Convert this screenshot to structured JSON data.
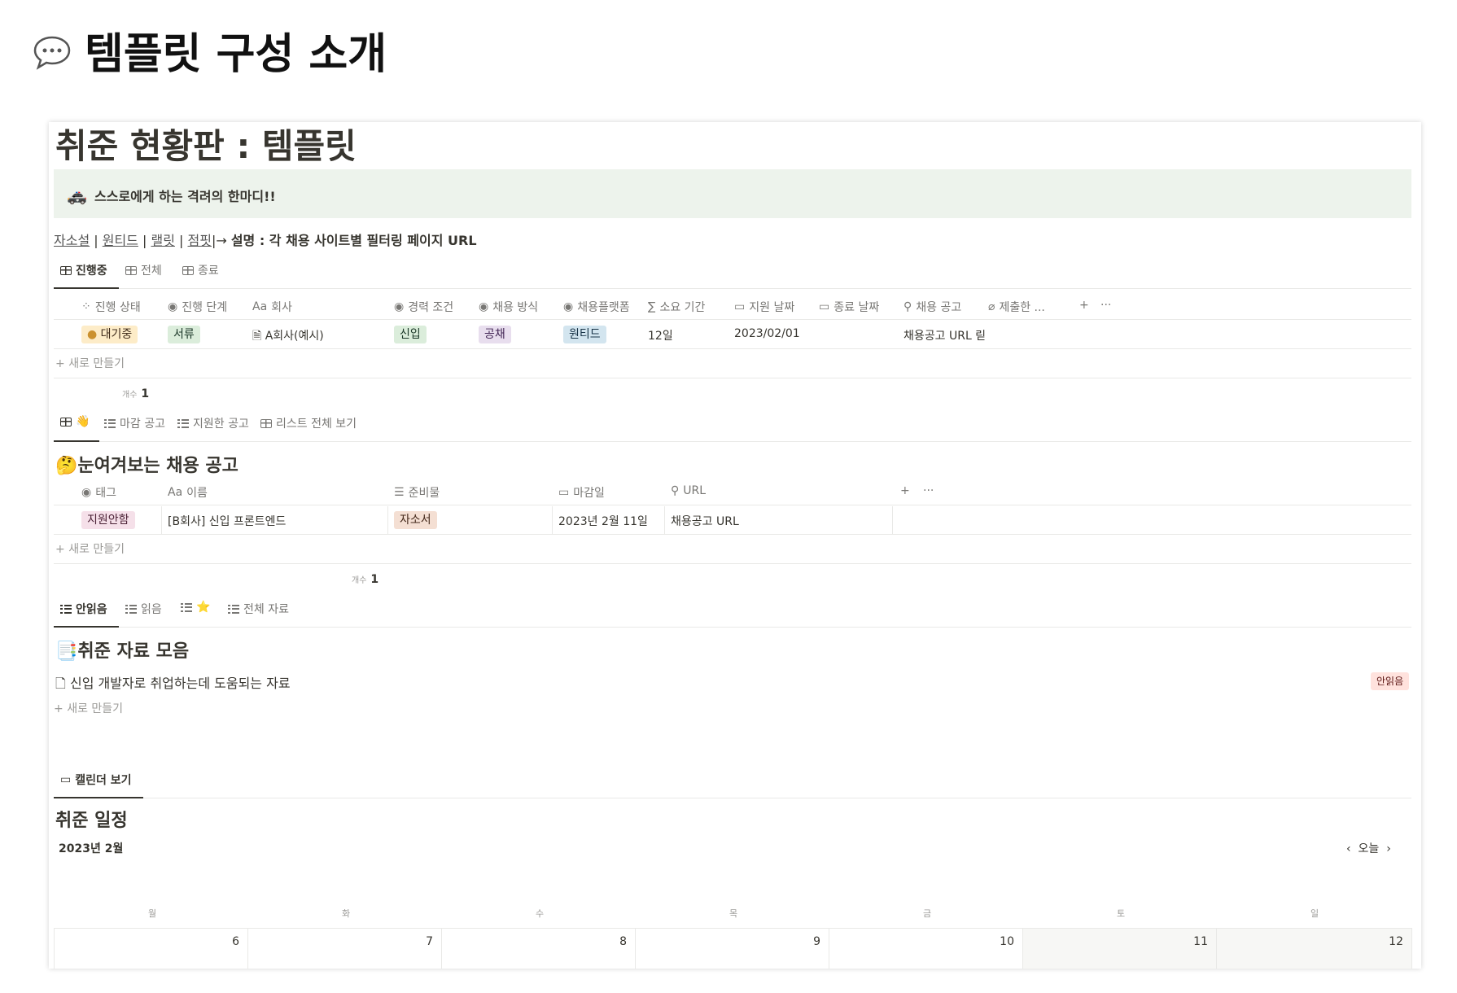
{
  "heading": {
    "text": "템플릿 구성 소개"
  },
  "page": {
    "title": "취준 현황판 : 템플릿"
  },
  "callout": {
    "icon": "🚓",
    "text": "스스로에게 하는 격려의 한마디!!"
  },
  "links": {
    "items": [
      "자소설",
      "원티드",
      "랠릿",
      "점핏"
    ],
    "separator": " | ",
    "arrow": "|→",
    "desc": "설명 : 각 채용 사이트별 필터링 페이지 URL"
  },
  "db1": {
    "tabs": [
      {
        "label": "진행중"
      },
      {
        "label": "전체"
      },
      {
        "label": "종료"
      }
    ],
    "columns": [
      {
        "icon": "⁘",
        "label": "진행 상태"
      },
      {
        "icon": "◉",
        "label": "진행 단계"
      },
      {
        "icon": "Aa",
        "label": "회사"
      },
      {
        "icon": "◉",
        "label": "경력 조건"
      },
      {
        "icon": "◉",
        "label": "채용 방식"
      },
      {
        "icon": "◉",
        "label": "채용플랫폼"
      },
      {
        "icon": "∑",
        "label": "소요 기간"
      },
      {
        "icon": "▭",
        "label": "지원 날짜"
      },
      {
        "icon": "▭",
        "label": "종료 날짜"
      },
      {
        "icon": "⚲",
        "label": "채용 공고"
      },
      {
        "icon": "⌀",
        "label": "제출한 ..."
      }
    ],
    "row": {
      "status": "대기중",
      "stage": "서류",
      "company": "A회사(예시)",
      "career": "신입",
      "method": "공채",
      "platform": "원티드",
      "duration": "12일",
      "applied": "2023/02/01",
      "url": "채용공고 URL 릳"
    },
    "new_label": "새로 만들기",
    "count_label": "개수",
    "count": "1",
    "add": "+",
    "more": "···"
  },
  "db2": {
    "tabs": [
      {
        "label": ""
      },
      {
        "label": "마감 공고"
      },
      {
        "label": "지원한 공고"
      },
      {
        "label": "리스트 전체 보기"
      }
    ],
    "title": "눈여겨보는 채용 공고",
    "title_icon": "🤔",
    "columns": [
      {
        "icon": "◉",
        "label": "태그"
      },
      {
        "icon": "Aa",
        "label": "이름"
      },
      {
        "icon": "☰",
        "label": "준비물"
      },
      {
        "icon": "▭",
        "label": "마감일"
      },
      {
        "icon": "⚲",
        "label": "URL"
      }
    ],
    "row": {
      "tag": "지원안함",
      "name": "[B회사] 신입 프론트엔드",
      "prep": "자소서",
      "deadline": "2023년 2월 11일",
      "url": "채용공고 URL"
    },
    "new_label": "새로 만들기",
    "count_label": "개수",
    "count": "1",
    "add": "+",
    "more": "···"
  },
  "db3": {
    "tabs": [
      {
        "label": "안읽음"
      },
      {
        "label": "읽음"
      },
      {
        "label": "⭐"
      },
      {
        "label": "전체 자료"
      }
    ],
    "title": "취준 자료 모음",
    "title_icon": "📑",
    "item": {
      "title": "신입 개발자로 취업하는데 도움되는 자료",
      "badge": "안읽음"
    },
    "new_label": "새로 만들기"
  },
  "calendar": {
    "tab": "캘린더 보기",
    "title": "취준 일정",
    "month": "2023년 2월",
    "today": "오늘",
    "weekdays": [
      "월",
      "화",
      "수",
      "목",
      "금",
      "토",
      "일"
    ],
    "days": [
      "6",
      "7",
      "8",
      "9",
      "10",
      "11",
      "12"
    ]
  }
}
